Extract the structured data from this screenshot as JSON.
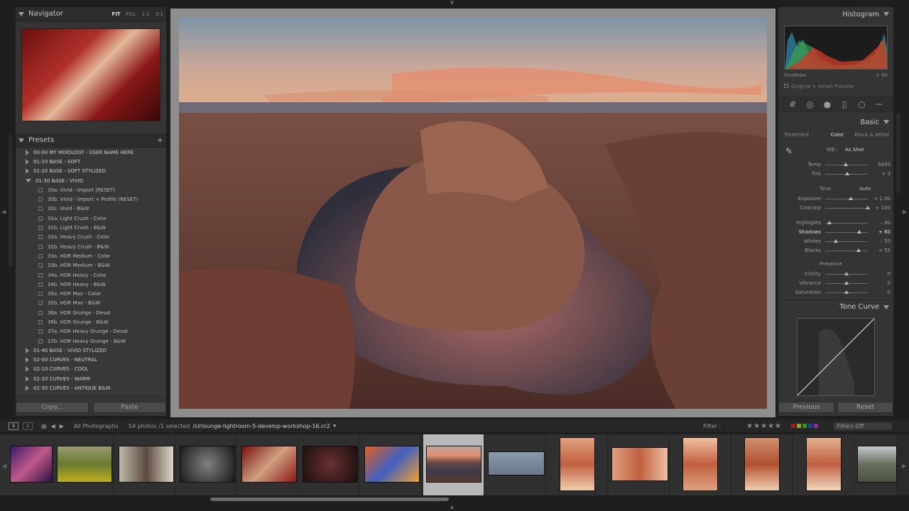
{
  "navigator": {
    "title": "Navigator",
    "modes": [
      "FIT",
      "FILL",
      "1:1",
      "3:1"
    ]
  },
  "presets": {
    "title": "Presets",
    "add_icon": "+",
    "items": [
      {
        "label": "00-00 MY MIXOLOGY - USER NAME HERE",
        "child": false
      },
      {
        "label": "01-10 BASE - SOFT",
        "child": false
      },
      {
        "label": "01-20 BASE - SOFT STYLIZED",
        "child": false
      },
      {
        "label": "01-30 BASE - VIVID",
        "child": false,
        "open": true
      },
      {
        "label": "30a. Vivid - Import (RESET)",
        "child": true
      },
      {
        "label": "30b. Vivid - Import + Profile (RESET)",
        "child": true
      },
      {
        "label": "30c. Vivid - B&W",
        "child": true
      },
      {
        "label": "31a. Light Crush - Color",
        "child": true
      },
      {
        "label": "31b. Light Crush - B&W",
        "child": true
      },
      {
        "label": "32a. Heavy Crush - Color",
        "child": true
      },
      {
        "label": "32b. Heavy Crush - B&W",
        "child": true
      },
      {
        "label": "33a. HDR Medium - Color",
        "child": true
      },
      {
        "label": "33b. HDR Medium - B&W",
        "child": true
      },
      {
        "label": "34a. HDR Heavy - Color",
        "child": true
      },
      {
        "label": "34b. HDR Heavy - B&W",
        "child": true
      },
      {
        "label": "35a. HDR Max - Color",
        "child": true
      },
      {
        "label": "35b. HDR Max - B&W",
        "child": true
      },
      {
        "label": "36a. HDR Grunge - Desat",
        "child": true
      },
      {
        "label": "36b. HDR Grunge - B&W",
        "child": true
      },
      {
        "label": "37a. HDR Heavy Grunge - Desat",
        "child": true
      },
      {
        "label": "37b. HDR Heavy Grunge - B&W",
        "child": true
      },
      {
        "label": "01-40 BASE - VIVID STYLIZED",
        "child": false
      },
      {
        "label": "02-00 CURVES - NEUTRAL",
        "child": false
      },
      {
        "label": "02-10 CURVES - COOL",
        "child": false
      },
      {
        "label": "02-20 CURVES - WARM",
        "child": false
      },
      {
        "label": "02-30 CURVES - ANTIQUE B&W",
        "child": false
      }
    ],
    "copy_label": "Copy...",
    "paste_label": "Paste"
  },
  "histogram": {
    "title": "Histogram",
    "readout_label": "Shadows",
    "readout_value": "+ 60",
    "smart_preview": "Original + Smart Preview"
  },
  "basic": {
    "title": "Basic",
    "treatment_label": "Treatment :",
    "treatment_color": "Color",
    "treatment_bw": "Black & White",
    "wb_label": "WB :",
    "wb_value": "As Shot",
    "tone_label": "Tone",
    "auto_label": "Auto",
    "presence_label": "Presence",
    "sliders": [
      {
        "label": "Temp",
        "value": "6450",
        "pos": 0.48
      },
      {
        "label": "Tint",
        "value": "+ 3",
        "pos": 0.52
      },
      {
        "label": "Exposure",
        "value": "+ 1.00",
        "pos": 0.6
      },
      {
        "label": "Contrast",
        "value": "+ 100",
        "pos": 1.0
      },
      {
        "label": "Highlights",
        "value": "– 80",
        "pos": 0.1
      },
      {
        "label": "Shadows",
        "value": "+ 60",
        "pos": 0.8,
        "highlight": true
      },
      {
        "label": "Whites",
        "value": "– 50",
        "pos": 0.25
      },
      {
        "label": "Blacks",
        "value": "+ 55",
        "pos": 0.78
      },
      {
        "label": "Clarity",
        "value": "0",
        "pos": 0.5
      },
      {
        "label": "Vibrance",
        "value": "0",
        "pos": 0.5
      },
      {
        "label": "Saturation",
        "value": "0",
        "pos": 0.5
      }
    ]
  },
  "tone_curve": {
    "title": "Tone Curve"
  },
  "right_buttons": {
    "previous": "Previous",
    "reset": "Reset"
  },
  "filmstrip_bar": {
    "page1": "1",
    "page2": "2",
    "source": "All Photographs",
    "count": "54 photos /1 selected",
    "filename": "/slrlounge-lightroom-5-develop-workshop-16.cr2",
    "filter_label": "Filter :",
    "filters_off": "Filters Off"
  },
  "colors": {
    "panel": "#343434",
    "bg": "#1e1e1e",
    "selected_cell": "#b8b8b8"
  }
}
